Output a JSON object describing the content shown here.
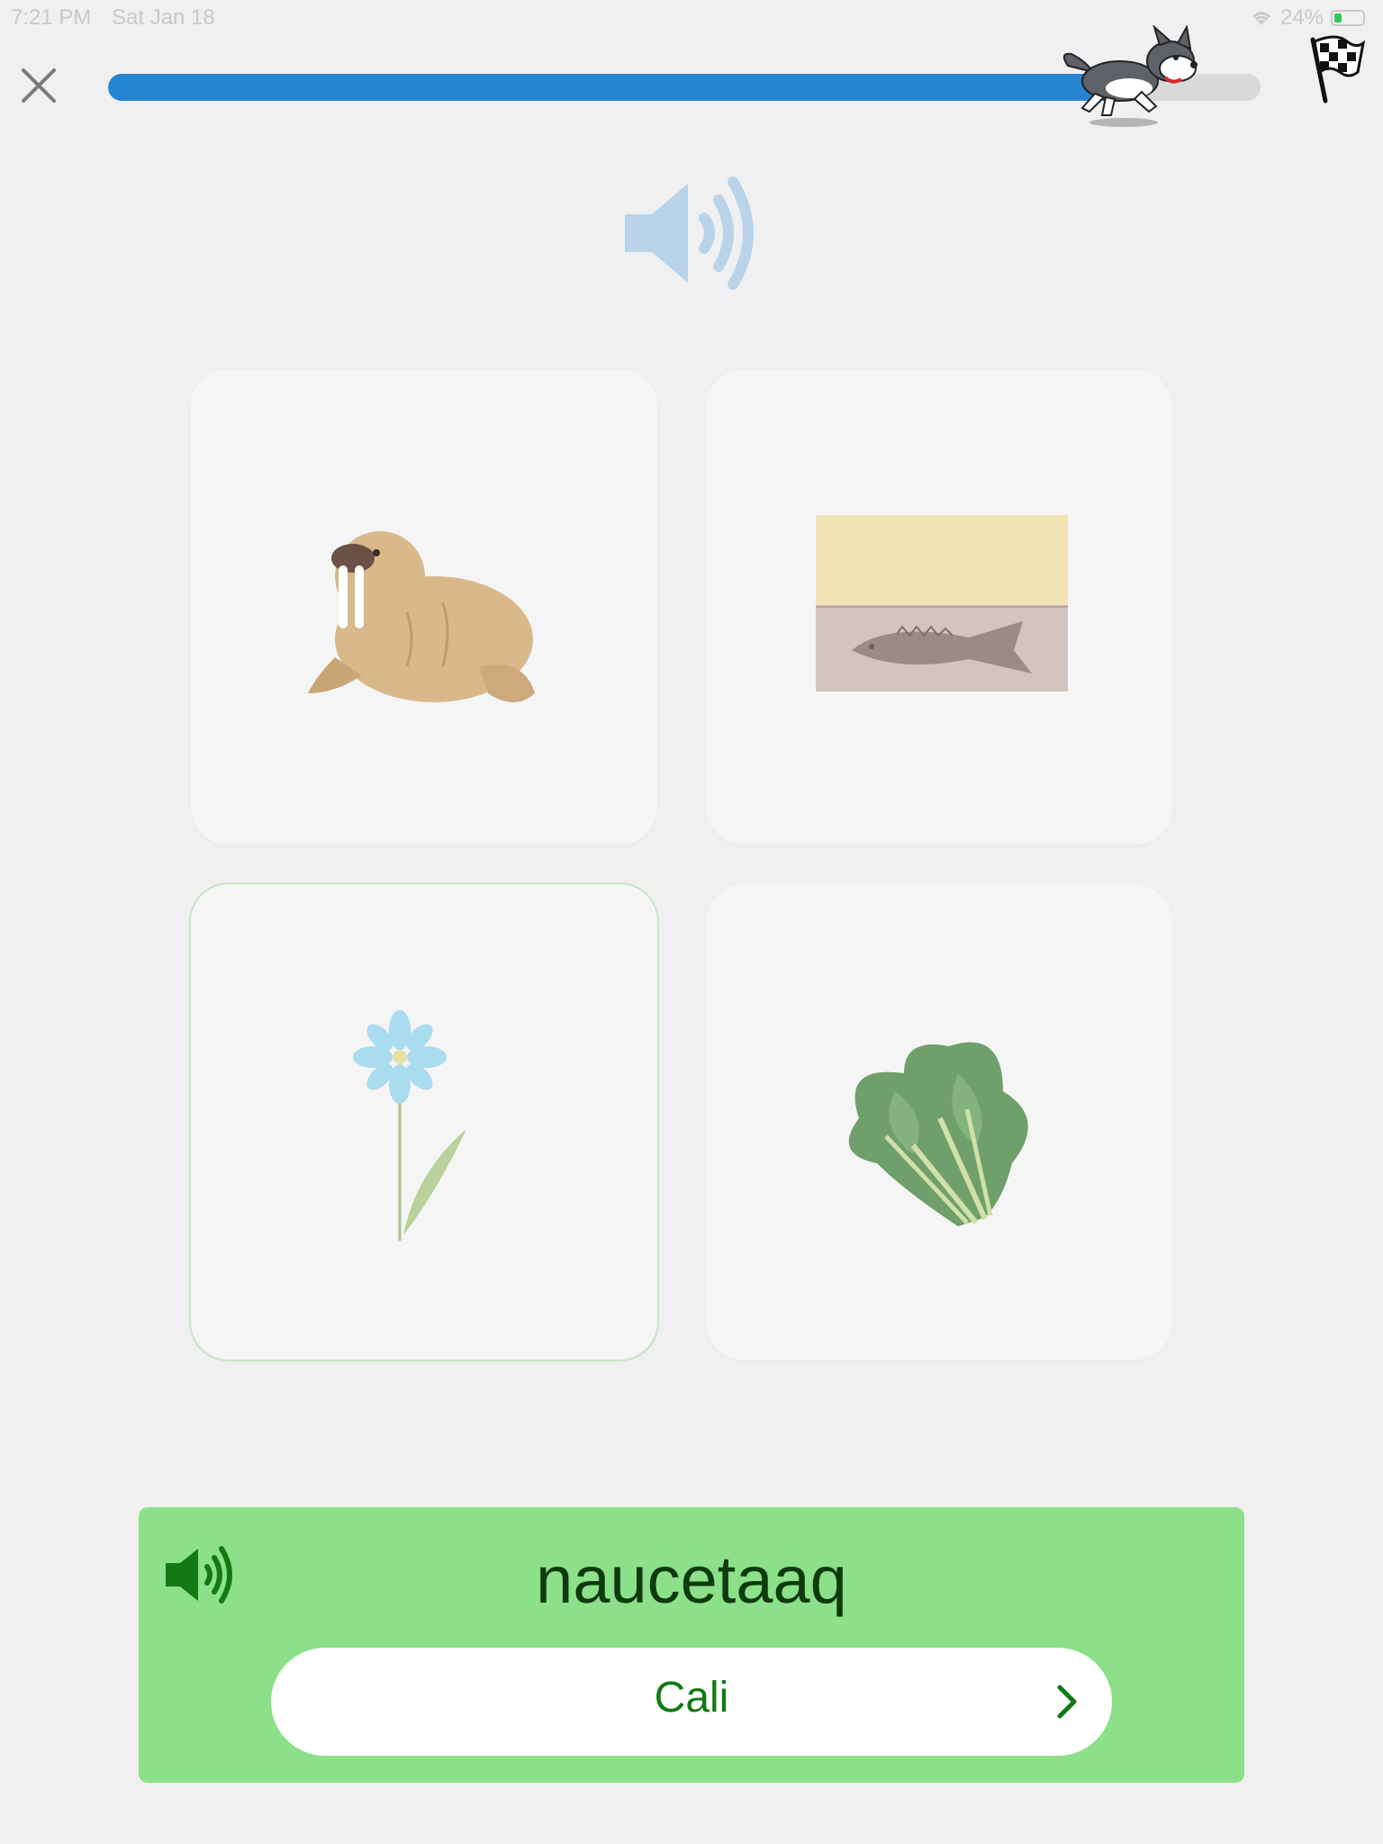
{
  "status_bar": {
    "time": "7:21 PM",
    "date": "Sat Jan 18",
    "battery": "24%",
    "icons": [
      "wifi-icon",
      "battery-icon"
    ]
  },
  "header": {
    "close_icon": "close-icon",
    "progress_fraction": 0.88,
    "progress_color": "#2585d3",
    "runner_icon": "husky-dog-icon",
    "finish_icon": "checkered-flag-icon"
  },
  "prompt": {
    "audio_icon": "speaker-icon",
    "audio_color": "#b8d3ea"
  },
  "choices": [
    {
      "id": "walrus",
      "image": "walrus-image",
      "selected": false
    },
    {
      "id": "fish-fossil",
      "image": "fish-in-sand-image",
      "selected": false
    },
    {
      "id": "flower",
      "image": "blue-flower-image",
      "selected": true
    },
    {
      "id": "greens",
      "image": "leafy-greens-image",
      "selected": false
    }
  ],
  "answer": {
    "word": "naucetaaq",
    "audio_icon": "speaker-icon",
    "continue_label": "Cali",
    "continue_icon": "chevron-right-icon",
    "panel_color": "#8ce089",
    "text_color": "#137a13"
  }
}
